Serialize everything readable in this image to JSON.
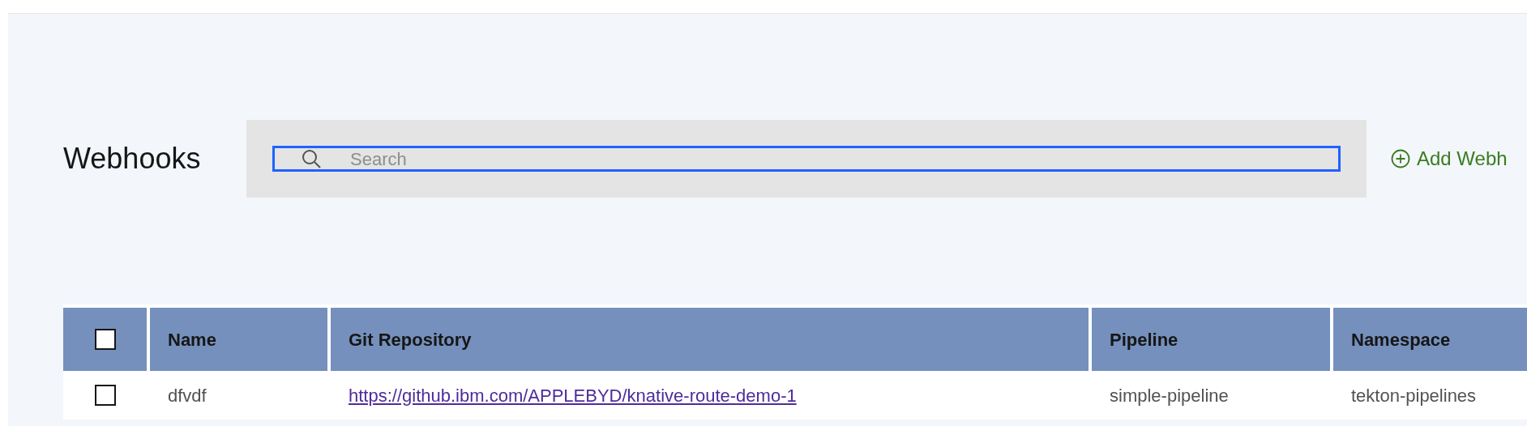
{
  "page": {
    "title": "Webhooks"
  },
  "search": {
    "placeholder": "Search",
    "focused": true
  },
  "add_button": {
    "label": "Add Webh"
  },
  "table": {
    "header_checkbox": {
      "checked": false
    },
    "columns": [
      {
        "label": "Name"
      },
      {
        "label": "Git Repository"
      },
      {
        "label": "Pipeline"
      },
      {
        "label": "Namespace"
      }
    ],
    "rows": [
      {
        "checked": false,
        "cells": [
          {
            "kind": "text",
            "text": "dfvdf"
          },
          {
            "kind": "link",
            "text": "https://github.ibm.com/APPLEBYD/knative-route-demo-1"
          },
          {
            "kind": "text",
            "text": "simple-pipeline"
          },
          {
            "kind": "text",
            "text": "tekton-pipelines"
          }
        ]
      }
    ]
  }
}
